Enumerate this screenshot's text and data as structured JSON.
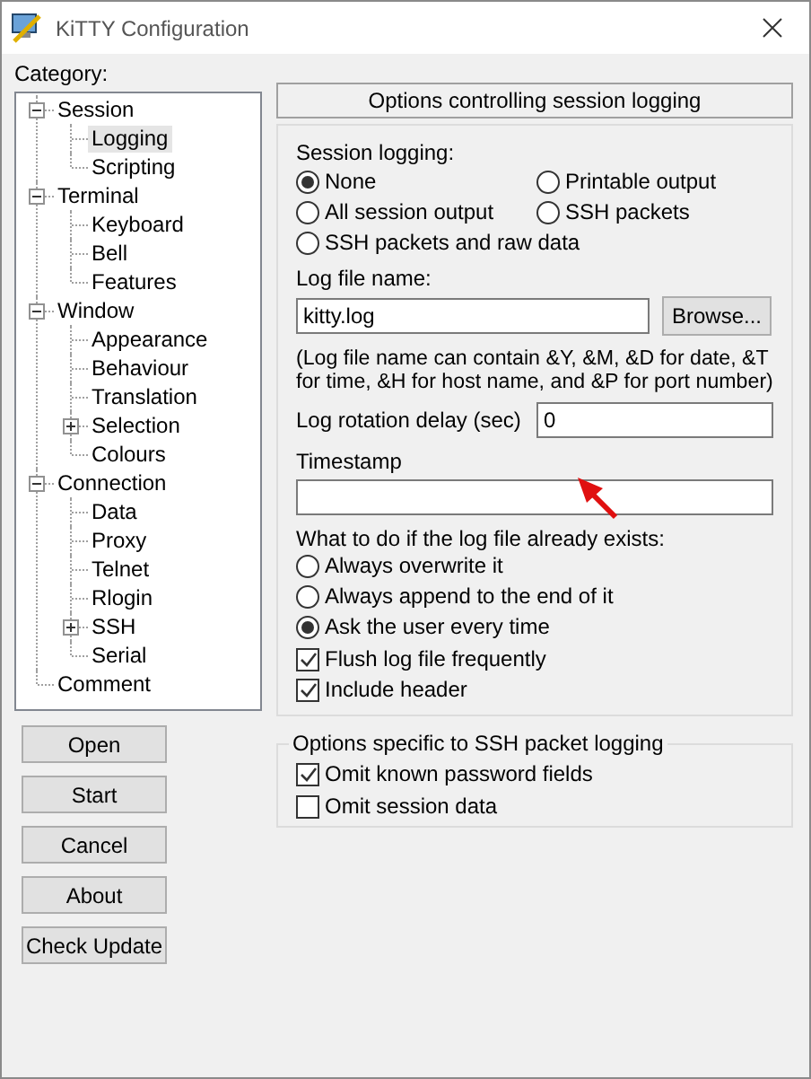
{
  "window": {
    "title": "KiTTY Configuration"
  },
  "category_label": "Category:",
  "tree": [
    {
      "label": "Session",
      "expanded": true,
      "selected": false,
      "children": [
        {
          "label": "Logging",
          "selected": true
        },
        {
          "label": "Scripting",
          "selected": false
        }
      ]
    },
    {
      "label": "Terminal",
      "expanded": true,
      "selected": false,
      "children": [
        {
          "label": "Keyboard",
          "selected": false
        },
        {
          "label": "Bell",
          "selected": false
        },
        {
          "label": "Features",
          "selected": false
        }
      ]
    },
    {
      "label": "Window",
      "expanded": true,
      "selected": false,
      "children": [
        {
          "label": "Appearance",
          "selected": false
        },
        {
          "label": "Behaviour",
          "selected": false
        },
        {
          "label": "Translation",
          "selected": false
        },
        {
          "label": "Selection",
          "expanded": false,
          "selected": false
        },
        {
          "label": "Colours",
          "selected": false
        }
      ]
    },
    {
      "label": "Connection",
      "expanded": true,
      "selected": false,
      "children": [
        {
          "label": "Data",
          "selected": false
        },
        {
          "label": "Proxy",
          "selected": false
        },
        {
          "label": "Telnet",
          "selected": false
        },
        {
          "label": "Rlogin",
          "selected": false
        },
        {
          "label": "SSH",
          "expanded": false,
          "selected": false
        },
        {
          "label": "Serial",
          "selected": false
        }
      ]
    },
    {
      "label": "Comment",
      "selected": false
    }
  ],
  "buttons": [
    "Open",
    "Start",
    "Cancel",
    "About",
    "Check Update"
  ],
  "panel": {
    "header": "Options controlling session logging",
    "session_logging": {
      "label": "Session logging:",
      "options": [
        {
          "label": "None",
          "selected": true
        },
        {
          "label": "Printable output",
          "selected": false
        },
        {
          "label": "All session output",
          "selected": false
        },
        {
          "label": "SSH packets",
          "selected": false
        },
        {
          "label": "SSH packets and raw data",
          "selected": false
        }
      ]
    },
    "log_file": {
      "label": "Log file name:",
      "value": "kitty.log",
      "browse": "Browse...",
      "note": "(Log file name can contain &Y, &M, &D for date, &T for time, &H for host name, and &P for port number)"
    },
    "rotation": {
      "label": "Log rotation delay (sec)",
      "value": "0"
    },
    "timestamp": {
      "label": "Timestamp"
    },
    "exists": {
      "label": "What to do if the log file already exists:",
      "options": [
        {
          "label": "Always overwrite it",
          "selected": false
        },
        {
          "label": "Always append to the end of it",
          "selected": false
        },
        {
          "label": "Ask the user every time",
          "selected": true
        }
      ]
    },
    "checks": [
      {
        "label": "Flush log file frequently",
        "checked": true
      },
      {
        "label": "Include header",
        "checked": true
      }
    ],
    "ssh_group": {
      "title": "Options specific to SSH packet logging",
      "checks": [
        {
          "label": "Omit known password fields",
          "checked": true
        },
        {
          "label": "Omit session data",
          "checked": false
        }
      ]
    }
  }
}
